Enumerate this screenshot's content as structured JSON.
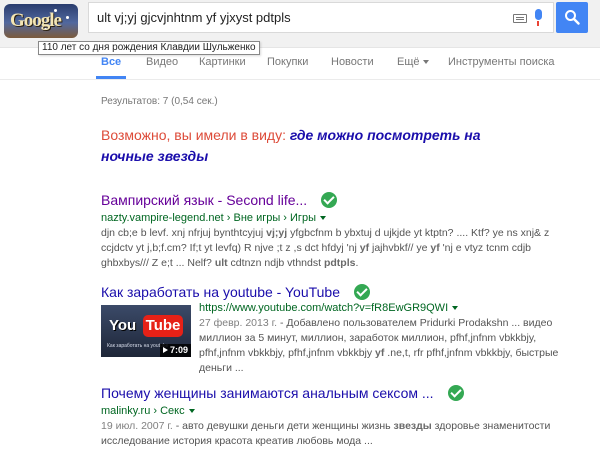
{
  "header": {
    "doodle_text": "Google",
    "query": "ult vj;yj gjcvjnhtnm yf yjxyst pdtpls",
    "tooltip": "110 лет со дня рождения Клавдии Шульженко",
    "keyboard_icon": "keyboard-icon",
    "mic_icon": "microphone-icon",
    "search_icon": "magnifier-icon",
    "accent_color": "#4285f4"
  },
  "tabs": [
    {
      "label": "Все",
      "active": true
    },
    {
      "label": "Видео"
    },
    {
      "label": "Картинки"
    },
    {
      "label": "Покупки"
    },
    {
      "label": "Новости"
    },
    {
      "label": "Ещё"
    },
    {
      "label": "Инструменты поиска"
    }
  ],
  "stats": "Результатов: 7 (0,54 сек.)",
  "did_you_mean": {
    "prefix": "Возможно, вы имели в виду:",
    "suggestion": "где можно посмотреть на ночные звезды"
  },
  "results": [
    {
      "title": "Вампирский язык - Second life...",
      "url": "nazty.vampire-legend.net",
      "crumbs": "› Вне игры › Игры",
      "snippet_html": "djn cb;e b levf. xnj nfrjuj bynthtcyjuj <b>vj;yj</b> yfgbcfnm b ybxtuj d ujkjde yt ktptn? .... Ktf? ye ns xnj&amp; z ccjdctv yt j,b;f.cm? If;t yt levfq) R njve ;t z ,s dct hfdyj 'nj <b>yf</b> jajhvbkf// ye <b>yf</b> 'nj e vtyz tcnm cdjb ghbxbys/// Z e;t ... Nelf? <b>ult</b> cdtnzn ndjb vthndst <b>pdtpls</b>.",
      "verified": true
    },
    {
      "title": "Как заработать на youtube - YouTube",
      "url": "https://www.youtube.com/watch?v=fR8EwGR9QWI",
      "date": "27 февр. 2013 г.",
      "snippet_html": "- Добавлено пользователем Pridurki Prodakshn ... видео миллион за 5 минут, миллион, заработок миллион, pfhf,jnfnm vbkkbjy, pfhf,jnfnm vbkkbjy, pfhf,jnfnm vbkkbjy <b>yf</b> .ne,t, rfr pfhf,jnfnm vbkkbjy, быстрые деньги ...",
      "verified": true,
      "thumb": {
        "you": "You",
        "tube": "Tube",
        "caption": "Как заработать на youtube",
        "duration": "7:09"
      }
    },
    {
      "title": "Почему женщины занимаются анальным сексом ...",
      "url": "malinky.ru",
      "crumbs": "› Секс",
      "date": "19 июл. 2007 г.",
      "snippet_html": "- авто девушки деньги дети женщины жизнь <b>звезды</b> здоровье знаменитости исследование история красота креатив любовь мода ...",
      "verified": true
    }
  ]
}
